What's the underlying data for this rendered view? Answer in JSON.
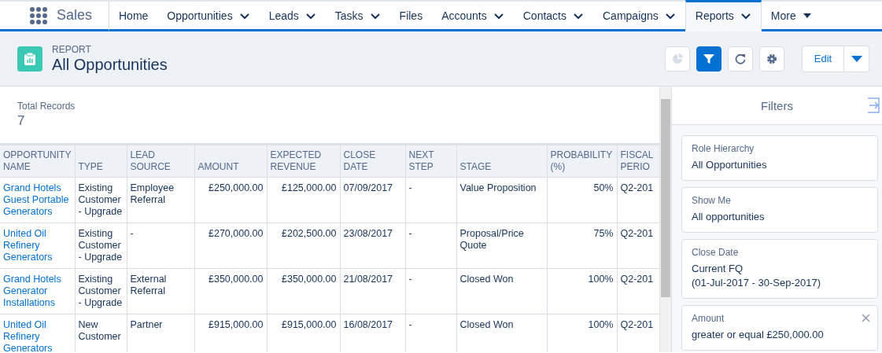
{
  "app": {
    "name": "Sales"
  },
  "tabs": [
    {
      "label": "Home",
      "kind": "plain",
      "selected": false
    },
    {
      "label": "Opportunities",
      "kind": "dropdown",
      "selected": false
    },
    {
      "label": "Leads",
      "kind": "dropdown",
      "selected": false
    },
    {
      "label": "Tasks",
      "kind": "dropdown",
      "selected": false
    },
    {
      "label": "Files",
      "kind": "plain",
      "selected": false
    },
    {
      "label": "Accounts",
      "kind": "dropdown",
      "selected": false
    },
    {
      "label": "Contacts",
      "kind": "dropdown",
      "selected": false
    },
    {
      "label": "Campaigns",
      "kind": "dropdown",
      "selected": false
    },
    {
      "label": "Reports",
      "kind": "dropdown",
      "selected": true
    },
    {
      "label": "More",
      "kind": "more",
      "selected": false
    }
  ],
  "header": {
    "eyebrow": "REPORT",
    "title": "All Opportunities",
    "tools": [
      {
        "kind": "chart",
        "disabled": true,
        "on": false
      },
      {
        "kind": "filter",
        "disabled": false,
        "on": true
      },
      {
        "kind": "refresh",
        "disabled": false,
        "on": false
      },
      {
        "kind": "settings",
        "disabled": false,
        "on": false
      }
    ],
    "edit_button": "Edit"
  },
  "summary": {
    "label": "Total Records",
    "value": "7"
  },
  "table": {
    "columns": [
      {
        "label": "OPPORTUNITY NAME"
      },
      {
        "label": "TYPE"
      },
      {
        "label": "LEAD SOURCE"
      },
      {
        "label": "AMOUNT"
      },
      {
        "label": "EXPECTED REVENUE"
      },
      {
        "label": "CLOSE DATE"
      },
      {
        "label": "NEXT STEP"
      },
      {
        "label": "STAGE"
      },
      {
        "label": "PROBABILITY (%)"
      },
      {
        "label": "FISCAL PERIO"
      }
    ],
    "rows": [
      [
        "Grand Hotels Guest Portable Generators",
        "Existing Customer - Upgrade",
        "Employee Referral",
        "£250,000.00",
        "£125,000.00",
        "07/09/2017",
        "-",
        "Value Proposition",
        "50%",
        "Q2-201"
      ],
      [
        "United Oil Refinery Generators",
        "Existing Customer - Upgrade",
        "-",
        "£270,000.00",
        "£202,500.00",
        "23/08/2017",
        "-",
        "Proposal/Price Quote",
        "75%",
        "Q2-201"
      ],
      [
        "Grand Hotels Generator Installations",
        "Existing Customer - Upgrade",
        "External Referral",
        "£350,000.00",
        "£350,000.00",
        "21/08/2017",
        "-",
        "Closed Won",
        "100%",
        "Q2-201"
      ],
      [
        "United Oil Refinery Generators",
        "New Customer",
        "Partner",
        "£915,000.00",
        "£915,000.00",
        "16/08/2017",
        "-",
        "Closed Won",
        "100%",
        "Q2-201"
      ]
    ]
  },
  "filters": {
    "title": "Filters",
    "items": [
      {
        "label": "Role Hierarchy",
        "value": [
          "All Opportunities"
        ],
        "removable": false
      },
      {
        "label": "Show Me",
        "value": [
          "All opportunities"
        ],
        "removable": false
      },
      {
        "label": "Close Date",
        "value": [
          "Current FQ",
          "(01-Jul-2017 - 30-Sep-2017)"
        ],
        "removable": false
      },
      {
        "label": "Amount",
        "value": [
          "greater or equal £250,000.00"
        ],
        "removable": true
      }
    ]
  }
}
